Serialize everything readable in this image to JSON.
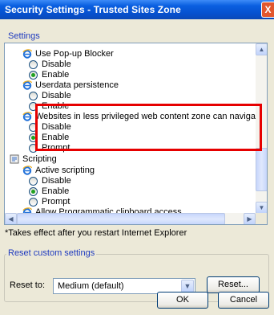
{
  "window": {
    "title": "Security Settings - Trusted Sites Zone",
    "close_label": "X"
  },
  "settings": {
    "legend": "Settings",
    "rows": [
      {
        "kind": "heading",
        "icon": "ie-icon",
        "label": "Use Pop-up Blocker"
      },
      {
        "kind": "option",
        "label": "Disable",
        "selected": false
      },
      {
        "kind": "option",
        "label": "Enable",
        "selected": true
      },
      {
        "kind": "heading",
        "icon": "ie-icon",
        "label": "Userdata persistence"
      },
      {
        "kind": "option",
        "label": "Disable",
        "selected": false
      },
      {
        "kind": "option",
        "label": "Enable",
        "selected": false
      },
      {
        "kind": "heading",
        "icon": "ie-icon",
        "label": "Websites in less privileged web content zone can navigate in"
      },
      {
        "kind": "option",
        "label": "Disable",
        "selected": false
      },
      {
        "kind": "option",
        "label": "Enable",
        "selected": true
      },
      {
        "kind": "option",
        "label": "Prompt",
        "selected": false
      },
      {
        "kind": "category",
        "icon": "scripting-icon",
        "label": "Scripting"
      },
      {
        "kind": "heading",
        "icon": "ie-icon",
        "label": "Active scripting"
      },
      {
        "kind": "option",
        "label": "Disable",
        "selected": false
      },
      {
        "kind": "option",
        "label": "Enable",
        "selected": true
      },
      {
        "kind": "option",
        "label": "Prompt",
        "selected": false
      },
      {
        "kind": "heading",
        "icon": "ie-icon",
        "label": "Allow Programmatic clipboard access"
      }
    ]
  },
  "note": "*Takes effect after you restart Internet Explorer",
  "reset": {
    "legend": "Reset custom settings",
    "label": "Reset to:",
    "selected": "Medium (default)",
    "button": "Reset..."
  },
  "footer": {
    "ok": "OK",
    "cancel": "Cancel"
  },
  "icons": {
    "scroll_up": "▲",
    "scroll_down": "▼",
    "scroll_left": "◀",
    "scroll_right": "▶",
    "combo": "▼"
  },
  "colors": {
    "titlebar": "#0a5fe0",
    "highlight": "#e60000",
    "radio_selected": "#21a121",
    "legend_text": "#1f3bbf"
  }
}
